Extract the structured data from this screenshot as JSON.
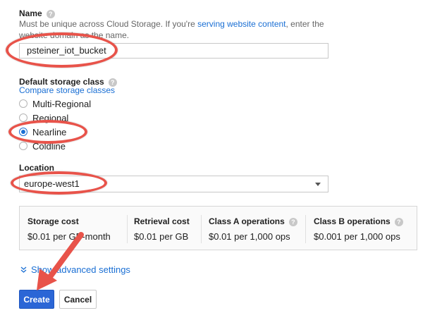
{
  "name_section": {
    "label": "Name",
    "hint_before": "Must be unique across Cloud Storage. If you're ",
    "hint_link": "serving website content",
    "hint_after": ", enter the website domain as the name.",
    "value": "psteiner_iot_bucket"
  },
  "storage_class": {
    "label": "Default storage class",
    "compare_link": "Compare storage classes",
    "options": [
      "Multi-Regional",
      "Regional",
      "Nearline",
      "Coldline"
    ],
    "selected": "Nearline"
  },
  "location": {
    "label": "Location",
    "value": "europe-west1"
  },
  "costs": {
    "columns": [
      {
        "header": "Storage cost",
        "value": "$0.01 per GB-month",
        "help": false
      },
      {
        "header": "Retrieval cost",
        "value": "$0.01 per GB",
        "help": false
      },
      {
        "header": "Class A operations",
        "value": "$0.01 per 1,000 ops",
        "help": true
      },
      {
        "header": "Class B operations",
        "value": "$0.001 per 1,000 ops",
        "help": true
      }
    ]
  },
  "advanced": {
    "label": "Show advanced settings"
  },
  "actions": {
    "create_label": "Create",
    "cancel_label": "Cancel"
  },
  "annotations": {
    "color": "#e8534a"
  },
  "icons": {
    "help": "question-mark-icon",
    "expand": "double-chevron-down-icon",
    "dropdown": "caret-down-icon"
  }
}
